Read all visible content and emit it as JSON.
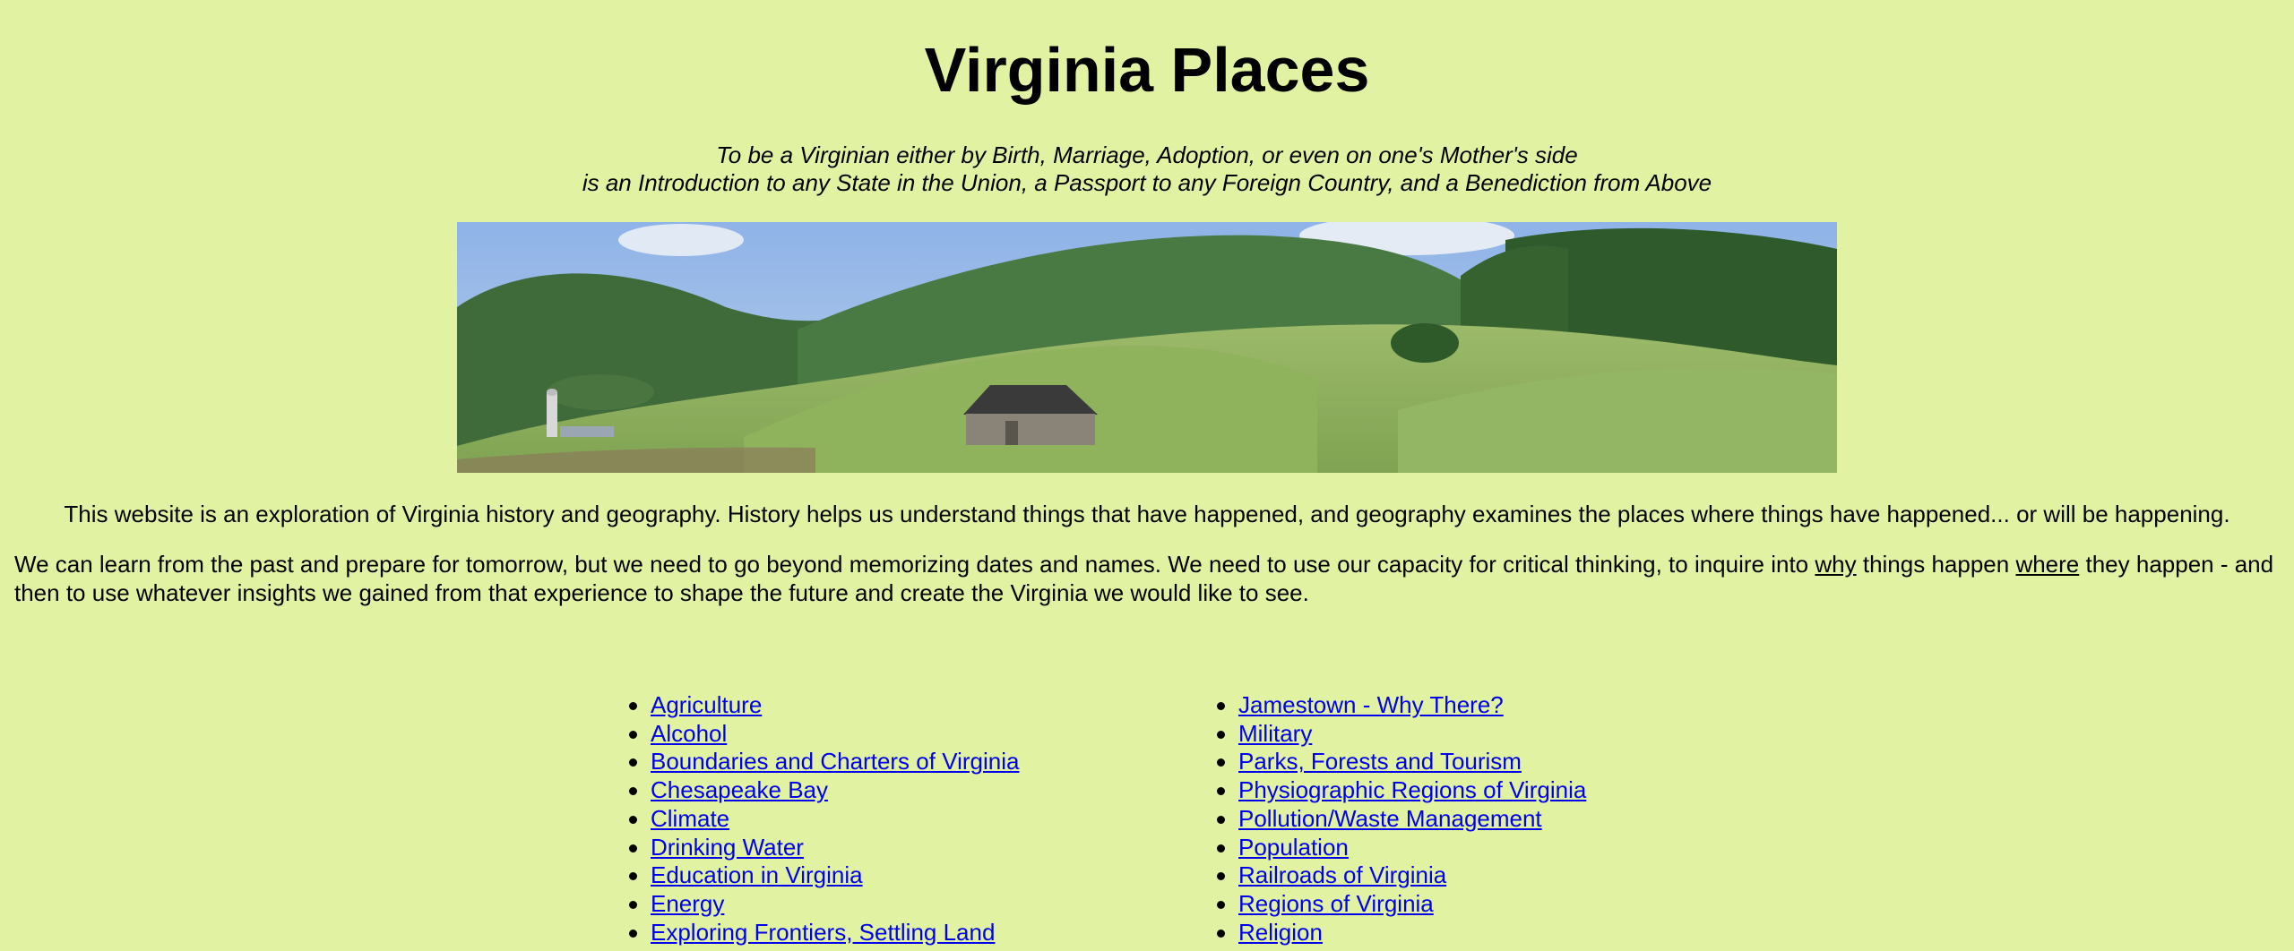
{
  "header": {
    "title": "Virginia Places",
    "motto_line1": "To be a Virginian either by Birth, Marriage, Adoption, or even on one's Mother's side",
    "motto_line2": "is an Introduction to any State in the Union, a Passport to any Foreign Country, and a Benediction from Above"
  },
  "banner": {
    "subject": "rolling green hills with a barn and silo beneath forested mountains"
  },
  "intro": {
    "paragraph1": "This website is an exploration of Virginia history and geography. History helps us understand things that have happened, and geography examines the places where things have happened... or will be happening.",
    "paragraph2_part1": "We can learn from the past and prepare for tomorrow, but we need to go beyond memorizing dates and names. We need to use our capacity for critical thinking, to inquire into ",
    "paragraph2_why": "why",
    "paragraph2_part2": " things happen ",
    "paragraph2_where": "where",
    "paragraph2_part3": " they happen - and then to use whatever insights we gained from that experience to shape the future and create the Virginia we would like to see."
  },
  "topics_left": [
    "Agriculture",
    "Alcohol",
    "Boundaries and Charters of Virginia",
    "Chesapeake Bay",
    "Climate",
    "Drinking Water",
    "Education in Virginia",
    "Energy",
    "Exploring Frontiers, Settling Land"
  ],
  "topics_right": [
    "Jamestown - Why There?",
    "Military",
    "Parks, Forests and Tourism",
    "Physiographic Regions of Virginia",
    "Pollution/Waste Management",
    "Population",
    "Railroads of Virginia",
    "Regions of Virginia",
    "Religion"
  ],
  "colors": {
    "background": "#e1f3a2",
    "link": "#0000ee"
  }
}
